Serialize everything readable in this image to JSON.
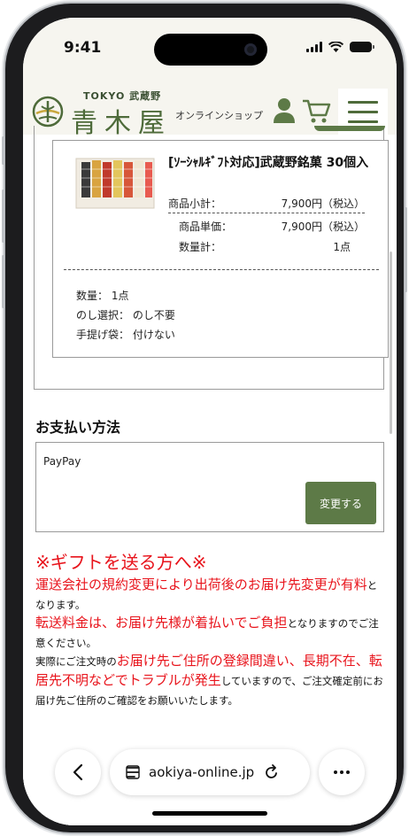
{
  "status_bar": {
    "time": "9:41"
  },
  "header": {
    "logo_sub": "TOKYO 武蔵野",
    "logo_main": "青木屋",
    "online_shop": "オンラインショップ"
  },
  "order": {
    "product_name": "[ｿｰｼｬﾙｷﾞﾌﾄ対応]武蔵野銘菓 30個入",
    "subtotal_label": "商品小計：",
    "subtotal_value": "7,900円（税込）",
    "unit_label": "商品単価：",
    "unit_value": "7,900円（税込）",
    "qty_total_label": "数量計：",
    "qty_total_value": "1点",
    "quantity": "数量： 1点",
    "noshi": "のし選択： のし不要",
    "bag": "手提げ袋： 付けない"
  },
  "payment": {
    "heading": "お支払い方法",
    "method": "PayPay",
    "change_button": "変更する"
  },
  "notice": {
    "title": "※ギフトを送る方へ※",
    "l1_red": "運送会社の規約変更により出荷後のお届け先変更が有料",
    "l1_black": "となります。",
    "l2_red": "転送料金は、お届け先様が着払いでご負担",
    "l2_black": "となりますのでご注意ください。",
    "l3_black_pre": "実際にご注文時の",
    "l3_red": "お届け先ご住所の登録間違い、長期不在、転居先不明などでトラブルが発生",
    "l3_black_post": "していますので、ご注文確定前にお届け先ご住所のご確認をお願いいたします。"
  },
  "browser": {
    "url": "aokiya-online.jp"
  },
  "icons": {
    "back": "chevron-left-icon",
    "page": "page-settings-icon",
    "reload": "reload-icon",
    "more": "ellipsis-icon",
    "user": "user-icon",
    "cart": "cart-icon",
    "menu": "hamburger-menu-icon"
  },
  "colors": {
    "brand_green": "#5d7a47",
    "notice_red": "#e8141c",
    "header_bg": "#f6f5ef"
  }
}
